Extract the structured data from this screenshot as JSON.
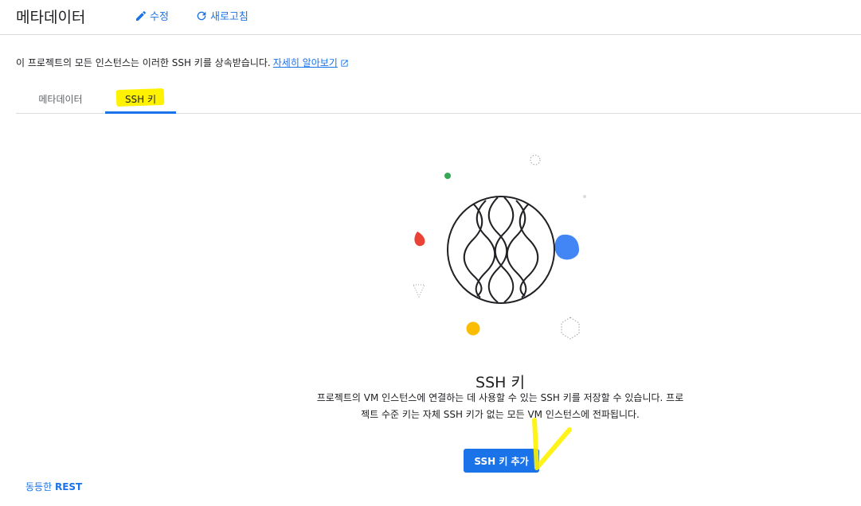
{
  "header": {
    "title": "메타데이터",
    "edit_label": "수정",
    "refresh_label": "새로고침"
  },
  "info": {
    "text": "이 프로젝트의 모든 인스턴스는 이러한 SSH 키를 상속받습니다.",
    "learn_more": "자세히 알아보기"
  },
  "tabs": [
    {
      "label": "메타데이터",
      "selected": false
    },
    {
      "label": "SSH 키",
      "selected": true
    }
  ],
  "empty_state": {
    "title": "SSH 키",
    "description": "프로젝트의 VM 인스턴스에 연결하는 데 사용할 수 있는 SSH 키를 저장할 수 있습니다. 프로젝트 수준 키는 자체 SSH 키가 없는 모든 VM 인스턴스에 전파됩니다.",
    "add_button": "SSH 키 추가"
  },
  "footer": {
    "rest_prefix": "동등한",
    "rest_label": "REST"
  },
  "colors": {
    "accent": "#1a73e8",
    "highlight": "#fff200",
    "red": "#ea4335",
    "green": "#34a853",
    "yellow": "#fbbc04",
    "blue": "#4285f4"
  }
}
